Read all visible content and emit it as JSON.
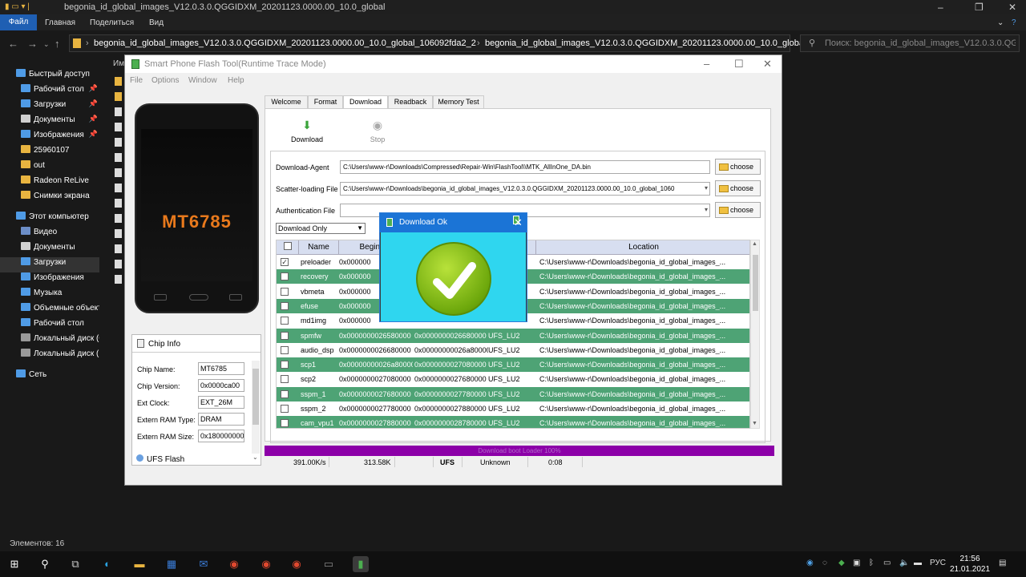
{
  "explorer": {
    "window_title": "begonia_id_global_images_V12.0.3.0.QGGIDXM_20201123.0000.00_10.0_global",
    "ribbon": [
      "Файл",
      "Главная",
      "Поделиться",
      "Вид"
    ],
    "breadcrumb": [
      "begonia_id_global_images_V12.0.3.0.QGGIDXM_20201123.0000.00_10.0_global_106092fda2_2",
      "begonia_id_global_images_V12.0.3.0.QGGIDXM_20201123.0000.00_10.0_global"
    ],
    "search_placeholder": "Поиск: begonia_id_global_images_V12.0.3.0.QGGIDXM...",
    "items_header": "Им",
    "nav": [
      {
        "label": "Быстрый доступ",
        "icon": "star-icon",
        "color": "#4f9be6"
      },
      {
        "label": "Рабочий стол",
        "icon": "desktop-icon",
        "color": "#4f9be6",
        "pinned": true
      },
      {
        "label": "Загрузки",
        "icon": "download-icon",
        "color": "#4f9be6",
        "pinned": true
      },
      {
        "label": "Документы",
        "icon": "document-icon",
        "color": "#d0d0d0",
        "pinned": true
      },
      {
        "label": "Изображения",
        "icon": "pictures-icon",
        "color": "#4f9be6",
        "pinned": true
      },
      {
        "label": "25960107",
        "icon": "folder-icon",
        "color": "#e8b440"
      },
      {
        "label": "out",
        "icon": "folder-icon",
        "color": "#e8b440"
      },
      {
        "label": "Radeon ReLive",
        "icon": "folder-icon",
        "color": "#e8b440"
      },
      {
        "label": "Снимки экрана",
        "icon": "folder-icon",
        "color": "#e8b440"
      },
      {
        "label": "Этот компьютер",
        "icon": "computer-icon",
        "color": "#4f9be6"
      },
      {
        "label": "Видео",
        "icon": "video-icon",
        "color": "#6c8ec8"
      },
      {
        "label": "Документы",
        "icon": "document-icon",
        "color": "#d0d0d0"
      },
      {
        "label": "Загрузки",
        "icon": "download-icon",
        "color": "#4f9be6",
        "selected": true
      },
      {
        "label": "Изображения",
        "icon": "pictures-icon",
        "color": "#4f9be6"
      },
      {
        "label": "Музыка",
        "icon": "music-icon",
        "color": "#4f9be6"
      },
      {
        "label": "Объемные объекты",
        "icon": "3d-objects-icon",
        "color": "#4f9be6"
      },
      {
        "label": "Рабочий стол",
        "icon": "desktop-icon",
        "color": "#4f9be6"
      },
      {
        "label": "Локальный диск (C:)",
        "icon": "drive-icon",
        "color": "#999999"
      },
      {
        "label": "Локальный диск (D:)",
        "icon": "drive-icon",
        "color": "#999999"
      },
      {
        "label": "Сеть",
        "icon": "network-icon",
        "color": "#4f9be6"
      }
    ],
    "status": "Элементов: 16"
  },
  "flash_tool": {
    "title": "Smart Phone Flash Tool(Runtime Trace Mode)",
    "menu": [
      "File",
      "Options",
      "Window",
      "Help"
    ],
    "phone_model": "MT6785",
    "tabs": [
      "Welcome",
      "Format",
      "Download",
      "Readback",
      "Memory Test"
    ],
    "active_tab": "Download",
    "toolbar": {
      "download": "Download",
      "stop": "Stop"
    },
    "fields": {
      "download_agent_label": "Download-Agent",
      "download_agent_value": "C:\\Users\\www-r\\Downloads\\Compressed\\Repair-Win\\FlashTool\\\\MTK_AllInOne_DA.bin",
      "scatter_label": "Scatter-loading File",
      "scatter_value": "C:\\Users\\www-r\\Downloads\\begonia_id_global_images_V12.0.3.0.QGGIDXM_20201123.0000.00_10.0_global_1060",
      "auth_label": "Authentication File",
      "auth_value": "",
      "choose": "choose"
    },
    "download_mode": "Download Only",
    "table": {
      "headers": [
        "Name",
        "Begin Ad",
        "",
        "",
        "Location"
      ],
      "rows": [
        {
          "checked": true,
          "name": "preloader",
          "begin": "0x000000",
          "end": "",
          "region": "U1",
          "location": "C:\\Users\\www-r\\Downloads\\begonia_id_global_images_..."
        },
        {
          "checked": false,
          "name": "recovery",
          "begin": "0x000000",
          "end": "",
          "region": "",
          "location": "C:\\Users\\www-r\\Downloads\\begonia_id_global_images_..."
        },
        {
          "checked": false,
          "name": "vbmeta",
          "begin": "0x000000",
          "end": "",
          "region": "",
          "location": "C:\\Users\\www-r\\Downloads\\begonia_id_global_images_..."
        },
        {
          "checked": false,
          "name": "efuse",
          "begin": "0x000000",
          "end": "",
          "region": "",
          "location": "C:\\Users\\www-r\\Downloads\\begonia_id_global_images_..."
        },
        {
          "checked": false,
          "name": "md1img",
          "begin": "0x000000",
          "end": "",
          "region": "",
          "location": "C:\\Users\\www-r\\Downloads\\begonia_id_global_images_..."
        },
        {
          "checked": false,
          "name": "spmfw",
          "begin": "0x0000000026580000",
          "end": "0x0000000026680000",
          "region": "UFS_LU2",
          "location": "C:\\Users\\www-r\\Downloads\\begonia_id_global_images_..."
        },
        {
          "checked": false,
          "name": "audio_dsp",
          "begin": "0x0000000026680000",
          "end": "0x00000000026a80000",
          "region": "UFS_LU2",
          "location": "C:\\Users\\www-r\\Downloads\\begonia_id_global_images_..."
        },
        {
          "checked": false,
          "name": "scp1",
          "begin": "0x00000000026a80000",
          "end": "0x0000000027080000",
          "region": "UFS_LU2",
          "location": "C:\\Users\\www-r\\Downloads\\begonia_id_global_images_..."
        },
        {
          "checked": false,
          "name": "scp2",
          "begin": "0x0000000027080000",
          "end": "0x0000000027680000",
          "region": "UFS_LU2",
          "location": "C:\\Users\\www-r\\Downloads\\begonia_id_global_images_..."
        },
        {
          "checked": false,
          "name": "sspm_1",
          "begin": "0x0000000027680000",
          "end": "0x0000000027780000",
          "region": "UFS_LU2",
          "location": "C:\\Users\\www-r\\Downloads\\begonia_id_global_images_..."
        },
        {
          "checked": false,
          "name": "sspm_2",
          "begin": "0x0000000027780000",
          "end": "0x0000000027880000",
          "region": "UFS_LU2",
          "location": "C:\\Users\\www-r\\Downloads\\begonia_id_global_images_..."
        },
        {
          "checked": false,
          "name": "cam_vpu1",
          "begin": "0x0000000027880000",
          "end": "0x0000000028780000",
          "region": "UFS_LU2",
          "location": "C:\\Users\\www-r\\Downloads\\begonia_id_global_images_..."
        }
      ]
    },
    "chip_info": {
      "title": "Chip Info",
      "rows": [
        {
          "label": "Chip Name:",
          "value": "MT6785"
        },
        {
          "label": "Chip Version:",
          "value": "0x0000ca00"
        },
        {
          "label": "Ext Clock:",
          "value": "EXT_26M"
        },
        {
          "label": "Extern RAM Type:",
          "value": "DRAM"
        },
        {
          "label": "Extern RAM Size:",
          "value": "0x180000000"
        }
      ],
      "storage": "UFS Flash"
    },
    "progress": {
      "text": "Download boot Loader 100%",
      "fraction": 1.0,
      "color": "#8c00a8"
    },
    "stats": {
      "speed": "391.00K/s",
      "size": "313.58K",
      "storage": "UFS",
      "type": "Unknown",
      "time": "0:08"
    }
  },
  "dialog": {
    "title": "Download Ok",
    "close": "✕"
  },
  "taskbar": {
    "apps": [
      "start-icon",
      "search-icon",
      "task-view-icon",
      "edge-icon",
      "file-explorer-icon",
      "store-icon",
      "mail-icon",
      "chrome-icon",
      "chrome-icon",
      "chrome-icon",
      "terminal-icon",
      "flashtool-icon"
    ],
    "language": "РУС",
    "time": "21:56",
    "date": "21.01.2021"
  }
}
